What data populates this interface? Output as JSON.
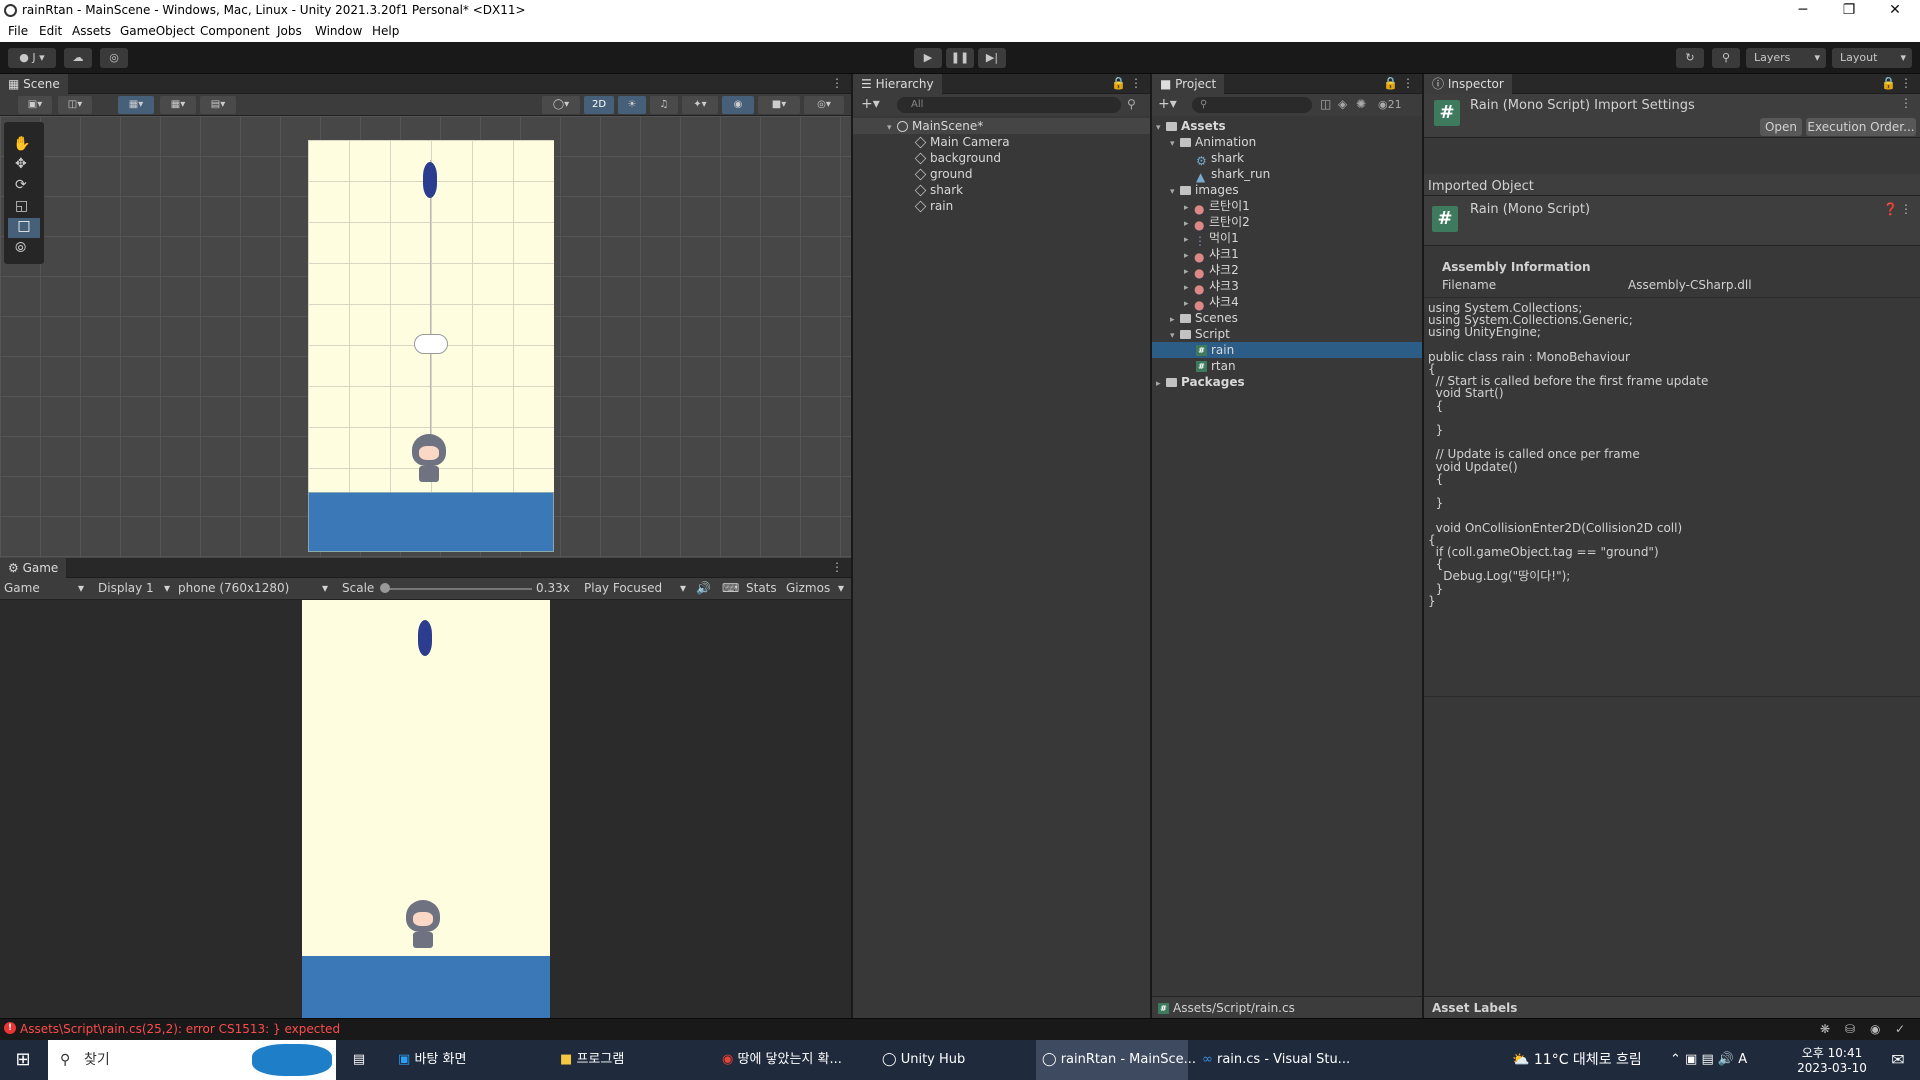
{
  "window": {
    "title": "rainRtan - MainScene - Windows, Mac, Linux - Unity 2021.3.20f1 Personal* <DX11>",
    "minimize": "─",
    "maximize": "❐",
    "close": "✕"
  },
  "menu": [
    "File",
    "Edit",
    "Assets",
    "GameObject",
    "Component",
    "Jobs",
    "Window",
    "Help"
  ],
  "toolbar": {
    "account": "J",
    "layers": "Layers",
    "layout": "Layout"
  },
  "scene": {
    "tab": "Scene",
    "mode_2d": "2D"
  },
  "game": {
    "tab": "Game",
    "view": "Game",
    "display": "Display 1",
    "resolution": "phone (760x1280)",
    "scale_label": "Scale",
    "scale_value": "0.33x",
    "play_mode": "Play Focused",
    "stats": "Stats",
    "gizmos": "Gizmos"
  },
  "hierarchy": {
    "tab": "Hierarchy",
    "search_placeholder": "All",
    "scene": "MainScene*",
    "items": [
      "Main Camera",
      "background",
      "ground",
      "shark",
      "rain"
    ]
  },
  "project": {
    "tab": "Project",
    "badge": "21",
    "root": "Assets",
    "animation_folder": "Animation",
    "animation_items": [
      "shark",
      "shark_run"
    ],
    "images_folder": "images",
    "image_items": [
      "르탄이1",
      "르탄이2",
      "먹이1",
      "샤크1",
      "샤크2",
      "샤크3",
      "샤크4"
    ],
    "scenes_folder": "Scenes",
    "script_folder": "Script",
    "script_items": [
      "rain",
      "rtan"
    ],
    "packages": "Packages",
    "footer_path": "Assets/Script/rain.cs"
  },
  "inspector": {
    "tab": "Inspector",
    "header_title": "Rain (Mono Script) Import Settings",
    "open_button": "Open",
    "exec_order_button": "Execution Order...",
    "imported_object": "Imported Object",
    "object_name": "Rain (Mono Script)",
    "assembly_info": "Assembly Information",
    "filename_label": "Filename",
    "filename_value": "Assembly-CSharp.dll",
    "code": "using System.Collections;\nusing System.Collections.Generic;\nusing UnityEngine;\n\npublic class rain : MonoBehaviour\n{\n  // Start is called before the first frame update\n  void Start()\n  {\n\n  }\n\n  // Update is called once per frame\n  void Update()\n  {\n\n  }\n\n  void OnCollisionEnter2D(Collision2D coll)\n{\n  if (coll.gameObject.tag == \"ground\")\n  {\n    Debug.Log(\"땅이다!\");\n  }\n}",
    "asset_labels": "Asset Labels"
  },
  "status": {
    "error": "Assets\\Script\\rain.cs(25,2): error CS1513: } expected"
  },
  "taskbar": {
    "search": "찾기",
    "items": [
      "바탕 화면",
      "프로그램",
      "땅에 닿았는지 확...",
      "Unity Hub",
      "rainRtan - MainSce...",
      "rain.cs - Visual Stu..."
    ],
    "weather": "11°C 대체로 흐림",
    "time": "오후 10:41",
    "date": "2023-03-10",
    "ime": "A"
  },
  "colors": {
    "accent": "#2c5d87",
    "ground": "#3b78b8",
    "sky": "#fffde0",
    "error": "#ff4c4c"
  }
}
